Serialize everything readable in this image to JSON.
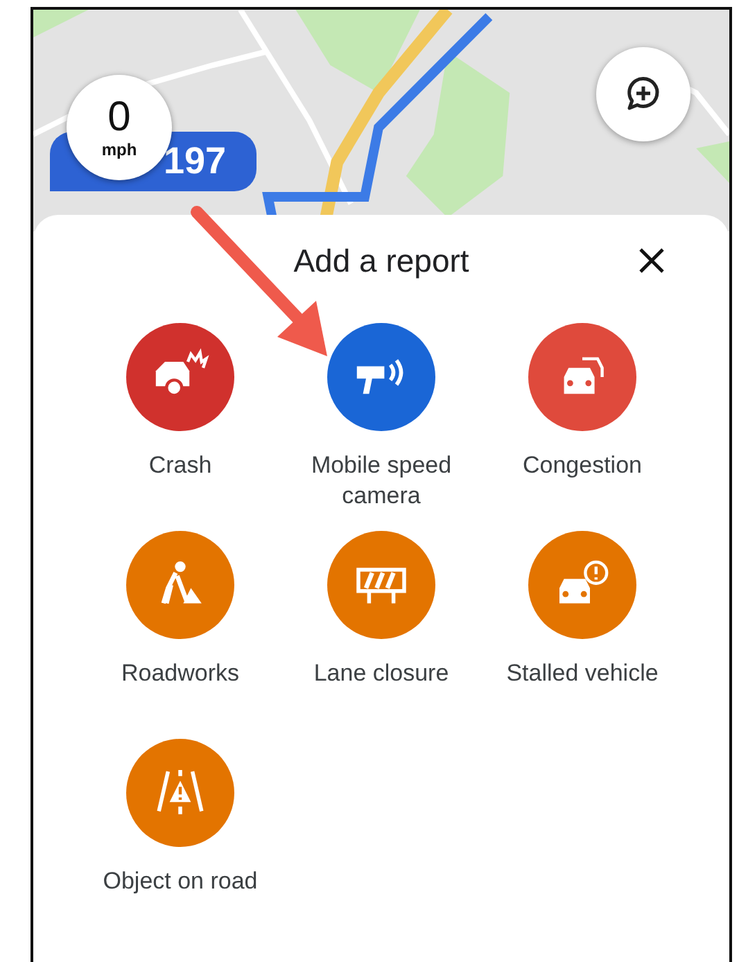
{
  "map": {
    "route_label": "197",
    "speed": {
      "value": "0",
      "unit": "mph"
    }
  },
  "sheet": {
    "title": "Add a report",
    "items": [
      {
        "kind": "crash",
        "label": "Crash",
        "color": "#d0312d"
      },
      {
        "kind": "speed_camera",
        "label": "Mobile speed camera",
        "color": "#1a66d6"
      },
      {
        "kind": "congestion",
        "label": "Congestion",
        "color": "#df4a3c"
      },
      {
        "kind": "roadworks",
        "label": "Roadworks",
        "color": "#e37400"
      },
      {
        "kind": "lane_closure",
        "label": "Lane closure",
        "color": "#e37400"
      },
      {
        "kind": "stalled",
        "label": "Stalled vehicle",
        "color": "#e37400"
      },
      {
        "kind": "object",
        "label": "Object on road",
        "color": "#e37400"
      }
    ]
  }
}
